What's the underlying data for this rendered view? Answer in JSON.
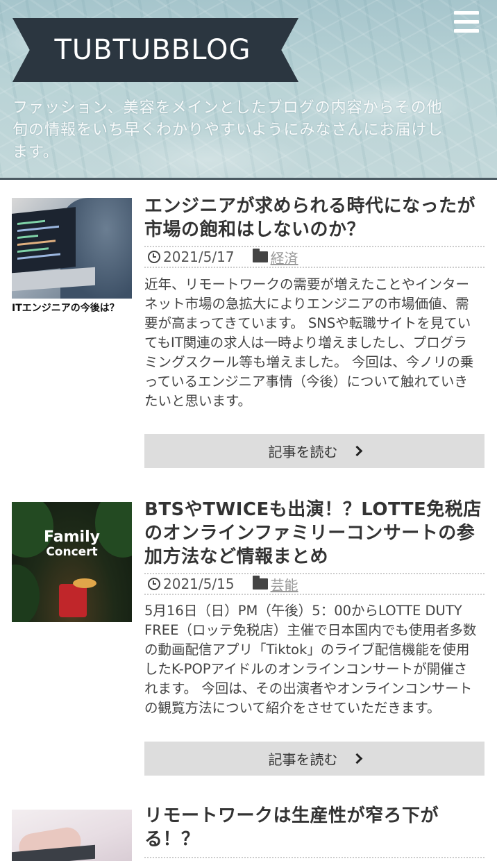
{
  "header": {
    "logo": "TUBTUBBLOG",
    "menu_icon": "hamburger-menu-icon",
    "tagline": "ファッション、美容をメインとしたブログの内容からその他旬の情報をいち早くわかりやすいようにみなさんにお届けします。"
  },
  "articles": [
    {
      "title": "エンジニアが求められる時代になったが市場の飽和はしないのか？",
      "date": "2021/5/17",
      "category": "経済",
      "excerpt": "近年、リモートワークの需要が増えたことやインターネット市場の急拡大によりエンジニアの市場価値、需要が高まってきています。 SNSや転職サイトを見ていてもIT関連の求人は一時より増えましたし、プログラミングスクール等も増えました。 今回は、今ノリの乗っているエンジニア事情（今後）について触れていきたいと思います。",
      "read_more": "記事を読む",
      "thumb_caption": "ITエンジニアの今後は？"
    },
    {
      "title": "BTSやTWICEも出演！？LOTTE免税店のオンラインファミリーコンサートの参加方法など情報まとめ",
      "date": "2021/5/15",
      "category": "芸能",
      "excerpt": "5月16日（日）PM（午後）5：00からLOTTE DUTY FREE（ロッテ免税店）主催で日本国内でも使用者多数の動画配信アプリ「Tiktok」のライブ配信機能を使用したK-POPアイドルのオンラインコンサートが開催されます。 今回は、その出演者やオンラインコンサートの観覧方法について紹介をさせていただきます。",
      "read_more": "記事を読む",
      "thumb_title_1": "Family",
      "thumb_title_2": "Concert"
    },
    {
      "title": "リモートワークは生産性が窄ろ下がる！？"
    }
  ],
  "icons": {
    "date": "clock-icon",
    "category": "folder-icon",
    "read_more": "chevron-right-icon"
  }
}
